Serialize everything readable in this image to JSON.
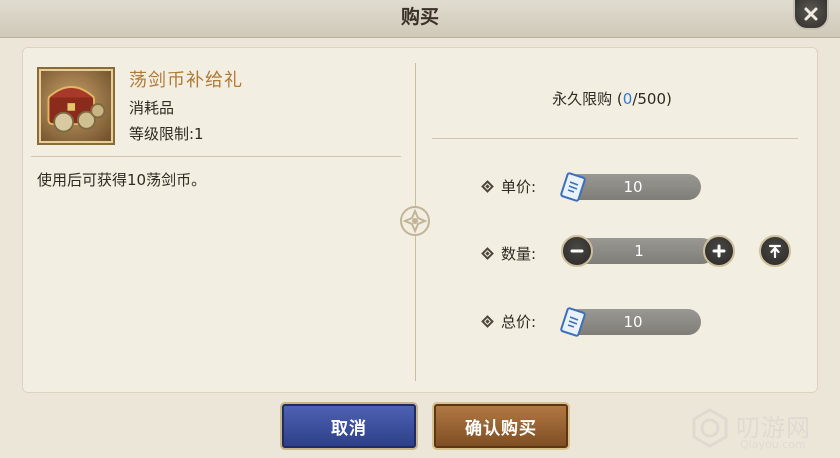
{
  "dialog": {
    "title": "购买"
  },
  "item": {
    "name": "荡剑币补给礼",
    "type": "消耗品",
    "level_limit": "等级限制:1",
    "description": "使用后可获得10荡剑币。"
  },
  "purchase": {
    "limit_label": "永久限购 (",
    "limit_used": "0",
    "limit_total": "/500)",
    "unit_price_label": "单价:",
    "unit_price": "10",
    "quantity_label": "数量:",
    "quantity": "1",
    "total_price_label": "总价:",
    "total_price": "10"
  },
  "buttons": {
    "cancel": "取消",
    "confirm": "确认购买"
  },
  "watermark": {
    "name": "叨游网",
    "domain": "Qiayou.com"
  },
  "colors": {
    "item_name": "#b07a38",
    "limit_highlight": "#2f7bd6",
    "cancel_button": "#3a4e9e",
    "confirm_button": "#9a6433"
  },
  "icons": {
    "close": "close-icon",
    "minus": "minus-icon",
    "plus": "plus-icon",
    "max": "max-icon",
    "currency": "ticket-icon"
  }
}
